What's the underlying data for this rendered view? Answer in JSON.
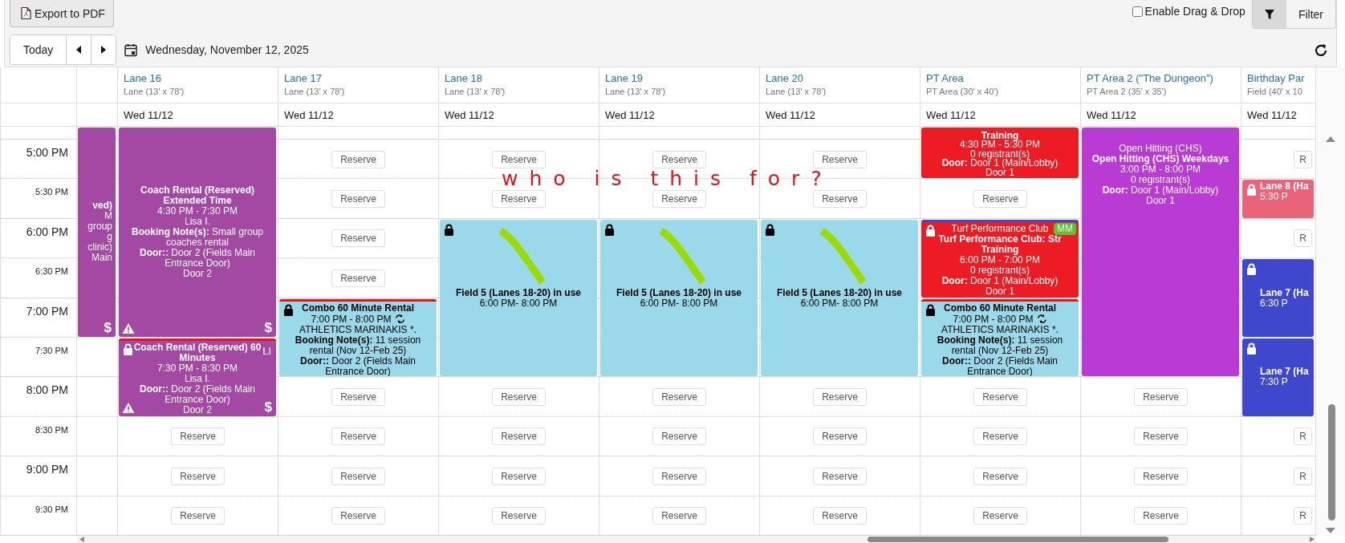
{
  "toolbar": {
    "export_button": "Export to PDF",
    "today_button": "Today",
    "date": "Wednesday, November 12, 2025",
    "drag_drop": {
      "label": "Enable Drag & Drop",
      "checked": false
    },
    "filter_button": "Filter"
  },
  "times": [
    {
      "label": "5:00 PM",
      "kind": "hour"
    },
    {
      "label": "5:30 PM",
      "kind": "half"
    },
    {
      "label": "6:00 PM",
      "kind": "hour"
    },
    {
      "label": "6:30 PM",
      "kind": "half"
    },
    {
      "label": "7:00 PM",
      "kind": "hour"
    },
    {
      "label": "7:30 PM",
      "kind": "half"
    },
    {
      "label": "8:00 PM",
      "kind": "hour"
    },
    {
      "label": "8:30 PM",
      "kind": "half"
    },
    {
      "label": "9:00 PM",
      "kind": "hour"
    },
    {
      "label": "9:30 PM",
      "kind": "half"
    }
  ],
  "columns": [
    {
      "kind": "partial-left",
      "events": [
        {
          "color": "#a349a4",
          "title": "ved)",
          "lines": [
            "M",
            "group",
            "g clinic)",
            "Main"
          ],
          "corner_mark": "$"
        }
      ]
    },
    {
      "kind": "full",
      "name": "Lane 16",
      "subtitle": "Lane (13' x 78')",
      "date": "Wed 11/12",
      "events": [
        {
          "color": "#a349a4",
          "title": "Coach Rental (Reserved) Extended Time",
          "lines": [
            "4:30 PM - 7:30 PM",
            "Lisa I.",
            "**Booking Note(s):** Small group coaches rental",
            "**Door::** Door 2 (Fields Main Entrance Door)",
            "Door 2"
          ],
          "warning": true,
          "corner_mark": "$"
        },
        {
          "color": "#a349a4",
          "kind": "alert",
          "locked": true,
          "tag": "LI",
          "title": "Coach Rental (Reserved) 60 Minutes",
          "lines": [
            "7:30 PM - 8:30 PM",
            "Lisa I.",
            "**Door::** Door 2 (Fields Main Entrance Door)",
            "Door 2"
          ],
          "warning": true,
          "corner_mark": "$"
        }
      ],
      "reserve_buttons": [
        "Reserve",
        "Reserve",
        "Reserve"
      ]
    },
    {
      "kind": "full",
      "name": "Lane 17",
      "subtitle": "Lane (13' x 78')",
      "date": "Wed 11/12",
      "events": [
        {
          "color": "#99d9ea",
          "kind": "alert",
          "locked": true,
          "recurring": true,
          "title": "Combo 60 Minute Rental",
          "lines": [
            "7:00 PM - 8:00 PM",
            "ATHLETICS MARINAKIS *.",
            "**Booking Note(s):** 11 session rental (Nov 12-Feb 25)",
            "**Door::** Door 2 (Fields Main Entrance Door)"
          ]
        }
      ],
      "reserve_buttons": [
        "Reserve",
        "Reserve",
        "Reserve",
        "Reserve",
        "Reserve",
        "Reserve",
        "Reserve",
        "Reserve"
      ]
    },
    {
      "kind": "full",
      "name": "Lane 18",
      "subtitle": "Lane (13' x 78')",
      "date": "Wed 11/12",
      "events": [
        {
          "color": "#99d9ea",
          "locked": true,
          "scribbled": true,
          "title": "Field 5 (Lanes 18-20) in use",
          "lines": [
            "6:00 PM- 8:00 PM"
          ]
        }
      ],
      "reserve_buttons": [
        "Reserve",
        "Reserve",
        "Reserve",
        "Reserve",
        "Reserve",
        "Reserve"
      ]
    },
    {
      "kind": "full",
      "name": "Lane 19",
      "subtitle": "Lane (13' x 78')",
      "date": "Wed 11/12",
      "events": [
        {
          "color": "#99d9ea",
          "locked": true,
          "scribbled": true,
          "title": "Field 5 (Lanes 18-20) in use",
          "lines": [
            "6:00 PM- 8:00 PM"
          ]
        }
      ],
      "reserve_buttons": [
        "Reserve",
        "Reserve",
        "Reserve",
        "Reserve",
        "Reserve",
        "Reserve"
      ]
    },
    {
      "kind": "full",
      "name": "Lane 20",
      "subtitle": "Lane (13' x 78')",
      "date": "Wed 11/12",
      "events": [
        {
          "color": "#99d9ea",
          "locked": true,
          "scribbled": true,
          "title": "Field 5 (Lanes 18-20) in use",
          "lines": [
            "6:00 PM- 8:00 PM"
          ]
        }
      ],
      "reserve_buttons": [
        "Reserve",
        "Reserve",
        "Reserve",
        "Reserve",
        "Reserve",
        "Reserve"
      ]
    },
    {
      "kind": "full",
      "name": "PT Area",
      "subtitle": "PT Area (30' x 40')",
      "date": "Wed 11/12",
      "events": [
        {
          "color": "#ed1c24",
          "title": "Training",
          "lines": [
            "4:30 PM - 5:30 PM",
            "0 registrant(s)",
            "**Door:** Door 1 (Main/Lobby)",
            "Door 1"
          ]
        },
        {
          "color": "#ed1c24",
          "kind": "member",
          "locked": true,
          "badge": {
            "text": "MM",
            "color": "#5ac42e"
          },
          "heading": "Turf Performance Club",
          "title": "Turf Performance Club: Str",
          "title_continued": "Training",
          "lines": [
            "6:00 PM - 7:00 PM",
            "0 registrant(s)",
            "**Door:** Door 1 (Main/Lobby)",
            "Door 1"
          ]
        },
        {
          "color": "#99d9ea",
          "kind": "alert",
          "locked": true,
          "recurring": true,
          "title": "Combo 60 Minute Rental",
          "lines": [
            "7:00 PM - 8:00 PM",
            "ATHLETICS MARINAKIS *.",
            "**Booking Note(s):** 11 session rental (Nov 12-Feb 25)",
            "**Door::** Door 2 (Fields Main Entrance Door)"
          ]
        }
      ],
      "reserve_buttons": [
        "Reserve",
        "Reserve",
        "Reserve",
        "Reserve",
        "Reserve"
      ]
    },
    {
      "kind": "full",
      "name": "PT Area 2 (\"The Dungeon\")",
      "subtitle": "PT Area 2 (35' x 35')",
      "date": "Wed 11/12",
      "events": [
        {
          "color": "#b93bd3",
          "heading": "Open Hitting (CHS)",
          "title": "Open Hitting (CHS) Weekdays",
          "lines": [
            "3:00 PM - 8:00 PM",
            "0 registrant(s)",
            "**Door:** Door 1 (Main/Lobby)",
            "Door 1"
          ]
        }
      ],
      "reserve_buttons": [
        "Reserve",
        "Reserve",
        "Reserve",
        "Reserve"
      ]
    },
    {
      "kind": "partial-right",
      "name": "Birthday Par",
      "subtitle": "Field (40' x 10",
      "date": "Wed 11/12",
      "events": [
        {
          "color": "#e9637b",
          "locked": true,
          "title": "Lane 8 (Ha",
          "lines": [
            "5:30 P"
          ]
        },
        {
          "color": "#3f48cc",
          "locked": true,
          "title": "Lane 7 (Ha",
          "lines": [
            "6:30 P"
          ]
        },
        {
          "color": "#3f48cc",
          "locked": true,
          "title": "Lane 7 (Ha",
          "lines": [
            "7:30 P"
          ]
        }
      ],
      "reserve_buttons": [
        "R",
        "R",
        "R",
        "R",
        "R"
      ]
    }
  ],
  "annotation": {
    "text": "who is this for?"
  }
}
